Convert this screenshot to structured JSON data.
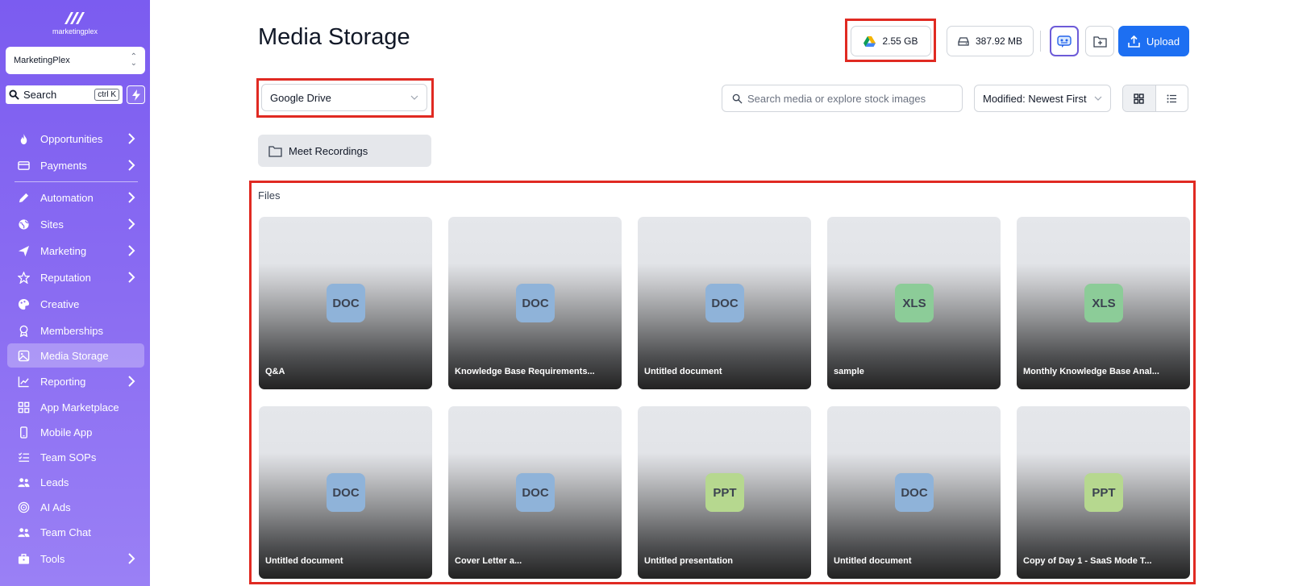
{
  "app": {
    "logo_text": "marketingplex"
  },
  "sidebar": {
    "account_name": "MarketingPlex",
    "search": {
      "label": "Search",
      "shortcut": "ctrl K"
    },
    "items": [
      {
        "label": "Opportunities",
        "icon": "flame-icon",
        "has_arrow": true,
        "active": false
      },
      {
        "label": "Payments",
        "icon": "credit-card-icon",
        "has_arrow": true,
        "active": false
      },
      {
        "label": "Automation",
        "icon": "pencil-icon",
        "has_arrow": true,
        "active": false
      },
      {
        "label": "Sites",
        "icon": "globe-icon",
        "has_arrow": true,
        "active": false
      },
      {
        "label": "Marketing",
        "icon": "send-icon",
        "has_arrow": true,
        "active": false
      },
      {
        "label": "Reputation",
        "icon": "star-icon",
        "has_arrow": true,
        "active": false
      },
      {
        "label": "Creative",
        "icon": "palette-icon",
        "has_arrow": false,
        "active": false
      },
      {
        "label": "Memberships",
        "icon": "award-icon",
        "has_arrow": false,
        "active": false
      },
      {
        "label": "Media Storage",
        "icon": "image-icon",
        "has_arrow": false,
        "active": true
      },
      {
        "label": "Reporting",
        "icon": "chart-icon",
        "has_arrow": true,
        "active": false
      },
      {
        "label": "App Marketplace",
        "icon": "grid-icon",
        "has_arrow": false,
        "active": false
      },
      {
        "label": "Mobile App",
        "icon": "phone-icon",
        "has_arrow": false,
        "active": false
      },
      {
        "label": "Team SOPs",
        "icon": "list-icon",
        "has_arrow": false,
        "active": false
      },
      {
        "label": "Leads",
        "icon": "users-icon",
        "has_arrow": false,
        "active": false
      },
      {
        "label": "AI Ads",
        "icon": "target-icon",
        "has_arrow": false,
        "active": false
      },
      {
        "label": "Team Chat",
        "icon": "users-icon",
        "has_arrow": false,
        "active": false
      },
      {
        "label": "Tools",
        "icon": "briefcase-icon",
        "has_arrow": true,
        "active": false
      }
    ]
  },
  "header": {
    "title": "Media Storage",
    "drive_usage": "2.55 GB",
    "local_usage": "387.92 MB",
    "upload_label": "Upload"
  },
  "toolbar": {
    "source": "Google Drive",
    "search_placeholder": "Search media or explore stock images",
    "sort": "Modified: Newest First"
  },
  "folders": [
    {
      "name": "Meet Recordings"
    }
  ],
  "files_label": "Files",
  "files": [
    {
      "type": "DOC",
      "name": "Q&A"
    },
    {
      "type": "DOC",
      "name": "Knowledge Base Requirements..."
    },
    {
      "type": "DOC",
      "name": "Untitled document"
    },
    {
      "type": "XLS",
      "name": "sample"
    },
    {
      "type": "XLS",
      "name": "Monthly Knowledge Base Anal..."
    },
    {
      "type": "DOC",
      "name": "Untitled document"
    },
    {
      "type": "DOC",
      "name": "Cover Letter a..."
    },
    {
      "type": "PPT",
      "name": "Untitled presentation"
    },
    {
      "type": "DOC",
      "name": "Untitled document"
    },
    {
      "type": "PPT",
      "name": "Copy of Day 1 - SaaS Mode T..."
    }
  ],
  "colors": {
    "accent": "#1d6ff2",
    "sidebar": "#7b5cf0",
    "highlight": "#e02a22"
  }
}
